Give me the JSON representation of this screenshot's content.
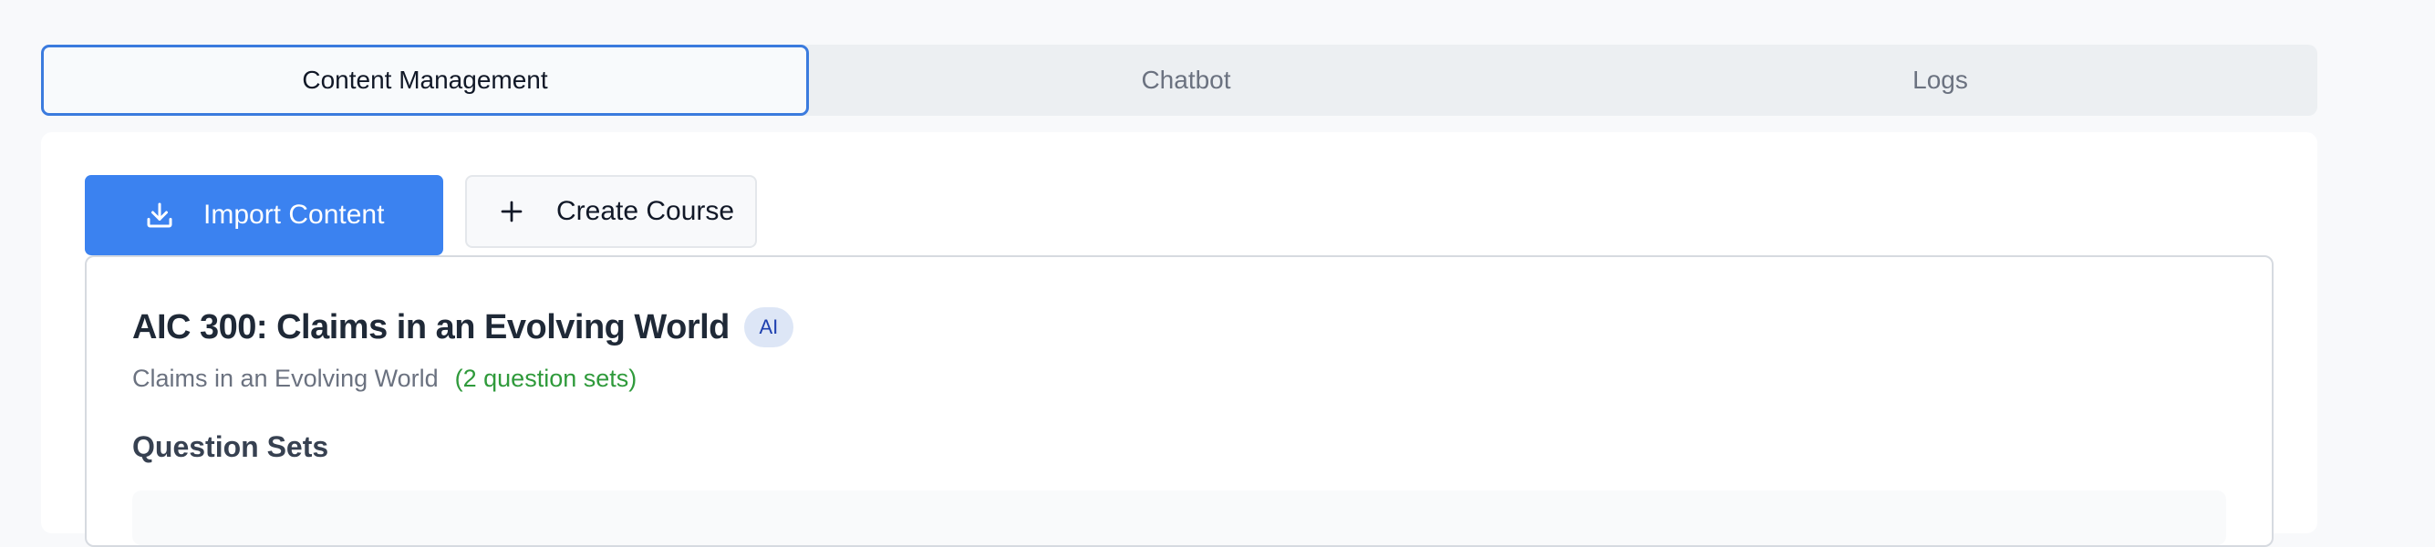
{
  "tabs": [
    {
      "label": "Content Management",
      "active": true
    },
    {
      "label": "Chatbot",
      "active": false
    },
    {
      "label": "Logs",
      "active": false
    }
  ],
  "toolbar": {
    "import_label": "Import Content",
    "import_icon": "download-icon",
    "create_label": "Create Course",
    "create_icon": "plus-icon"
  },
  "course": {
    "title": "AIC 300: Claims in an Evolving World",
    "badge": "AI",
    "subtitle": "Claims in an Evolving World",
    "count": "(2 question sets)",
    "section_heading": "Question Sets"
  },
  "colors": {
    "accent": "#3b82f0",
    "active_tab_border": "#3b7bde",
    "count_text": "#2f9a3b",
    "badge_bg": "#dde6f6"
  }
}
